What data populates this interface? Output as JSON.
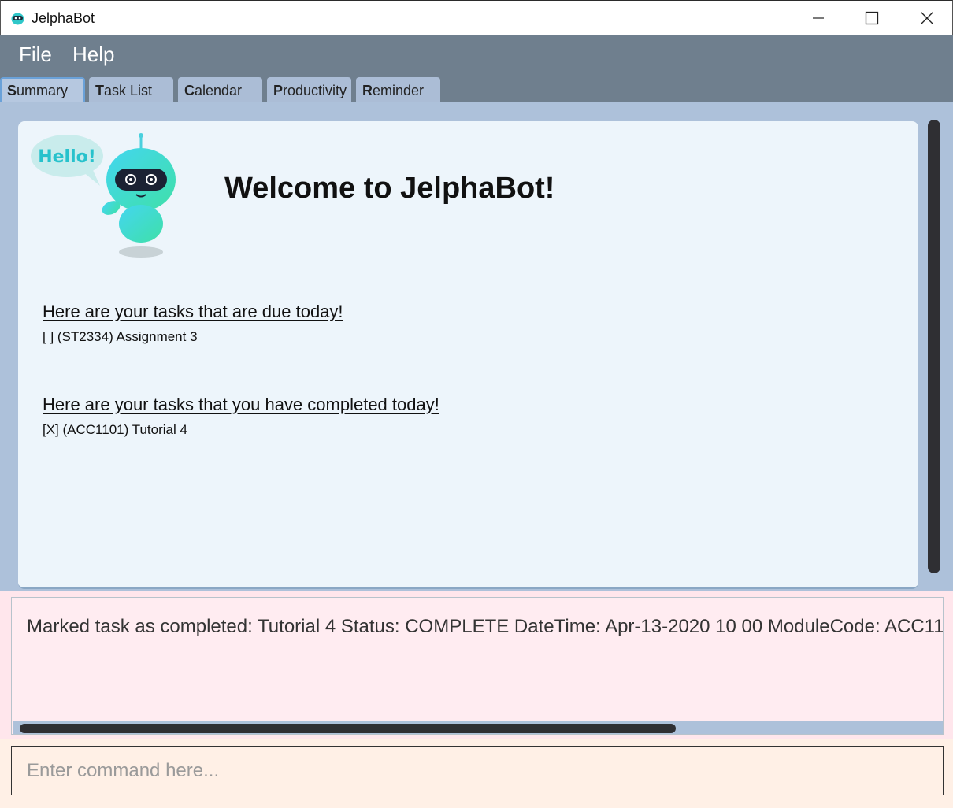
{
  "window": {
    "title": "JelphaBot",
    "icons": [
      "app-icon",
      "minimize-icon",
      "maximize-icon",
      "close-icon"
    ]
  },
  "menu": {
    "file": "File",
    "help": "Help"
  },
  "tabs": [
    {
      "accel": "S",
      "rest": "ummary",
      "active": true
    },
    {
      "accel": "T",
      "rest": "ask List",
      "active": false
    },
    {
      "accel": "C",
      "rest": "alendar",
      "active": false
    },
    {
      "accel": "P",
      "rest": "roductivity",
      "active": false
    },
    {
      "accel": "R",
      "rest": "eminder",
      "active": false
    }
  ],
  "summary": {
    "bot_speech": "Hello!",
    "welcome": "Welcome to JelphaBot!",
    "due_heading": "Here are your tasks that are due today!",
    "due_tasks": [
      "[ ] (ST2334) Assignment 3"
    ],
    "completed_heading": "Here are your tasks that you have completed today!",
    "completed_tasks": [
      "[X] (ACC1101) Tutorial 4"
    ]
  },
  "result": {
    "text": "Marked task as completed: Tutorial 4 Status: COMPLETE DateTime: Apr-13-2020 10 00 ModuleCode: ACC11"
  },
  "command": {
    "placeholder": "Enter command here..."
  },
  "colors": {
    "menubar": "#6f7f8e",
    "main_bg": "#adc1da",
    "panel_bg": "#edf5fb",
    "result_bg": "#ffecf1",
    "command_bg": "#fff0e6"
  }
}
